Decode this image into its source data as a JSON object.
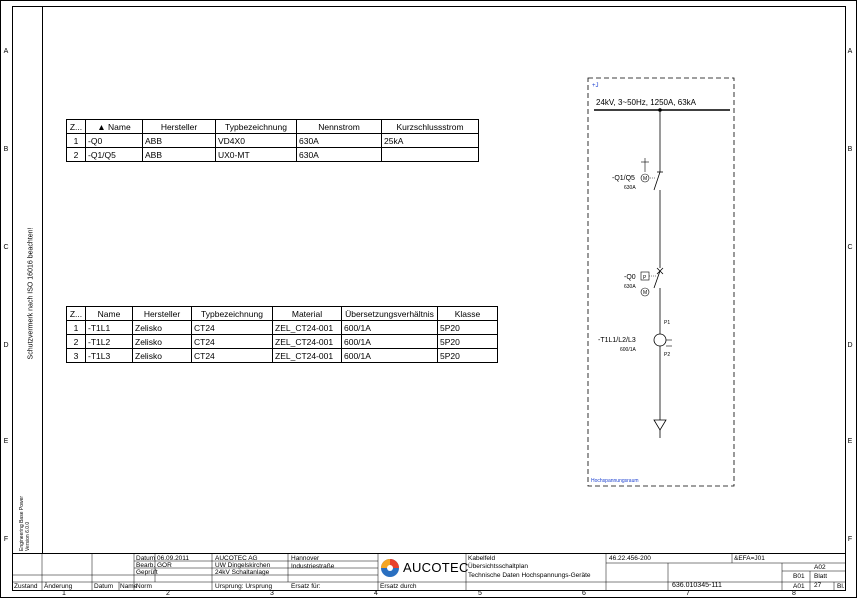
{
  "frame": {
    "row_labels": [
      "A",
      "B",
      "C",
      "D",
      "E",
      "F"
    ],
    "col_labels": [
      "1",
      "2",
      "3",
      "4",
      "5",
      "6",
      "7",
      "8"
    ],
    "side_note": "Schutzvermerk nach ISO 16016 beachten!",
    "version_note": "Engineering Base Power\nVersion 6.0.0"
  },
  "table1": {
    "headers": [
      "Z...",
      "▲  Name",
      "Hersteller",
      "Typbezeichnung",
      "Nennstrom",
      "Kurzschlussstrom"
    ],
    "rows": [
      [
        "1",
        "-Q0",
        "ABB",
        "VD4X0",
        "630A",
        "25kA"
      ],
      [
        "2",
        "-Q1/Q5",
        "ABB",
        "UX0-MT",
        "630A",
        ""
      ]
    ]
  },
  "table2": {
    "headers": [
      "Z...",
      "Name",
      "Hersteller",
      "Typbezeichnung",
      "Material",
      "Übersetzungsverhältnis",
      "Klasse"
    ],
    "rows": [
      [
        "1",
        "-T1L1",
        "Zelisko",
        "CT24",
        "ZEL_CT24-001",
        "600/1A",
        "5P20"
      ],
      [
        "2",
        "-T1L2",
        "Zelisko",
        "CT24",
        "ZEL_CT24-001",
        "600/1A",
        "5P20"
      ],
      [
        "3",
        "-T1L3",
        "Zelisko",
        "CT24",
        "ZEL_CT24-001",
        "600/1A",
        "5P20"
      ]
    ]
  },
  "schematic": {
    "location_tag": "+J",
    "busbar_text": "24kV, 3~50Hz, 1250A, 63kA",
    "q1_label": "-Q1/Q5",
    "q1_rating": "630A",
    "q0_label": "-Q0",
    "q0_rating": "630A",
    "ct_label": "-T1L1/L2/L3",
    "ct_ratio": "600/1A",
    "p1": "P1",
    "p2": "P2",
    "m_symbol": "M",
    "p_symbol": "P",
    "area_name": "Hochspannungsraum"
  },
  "title_block": {
    "datum_label": "Datum",
    "datum_value": "06.09.2011",
    "bearb_label": "Bearb.",
    "bearb_value": "GOR",
    "gepr_label": "Geprüft",
    "norm_label": "Norm",
    "zustand_label": "Zustand",
    "aenderung_label": "Änderung",
    "aend_datum_label": "Datum",
    "name_label": "Name",
    "company1": "AUCOTEC AG",
    "company2": "UW Dingelskirchen",
    "company3": "24kV Schaltanlage",
    "city1": "Hannover",
    "city2": "Industriestraße",
    "ursprung": "Ursprung: Ursprung",
    "ersatz_fuer": "Ersatz für:",
    "ersatz_durch": "Ersatz durch",
    "logo_text": "AUCOTEC",
    "desc1": "Kabelfeld",
    "desc2": "Übersichtsschaltplan",
    "desc3": "Technische Daten Hochspannungs-Geräte",
    "code1": "46.22.456-200",
    "code2": "&EFA=J01",
    "code3": "A02",
    "blatt_prev": "B01",
    "blatt_label": "Blatt",
    "drawing_no": "636.010345-111",
    "sheet_a": "A01",
    "sheet_num": "27",
    "bl_label": "Bl."
  },
  "colors": {
    "logo_red": "#e8412c",
    "logo_orange": "#f5a623",
    "logo_blue": "#2a6fc0",
    "schematic_blue": "#1a3fd0"
  }
}
